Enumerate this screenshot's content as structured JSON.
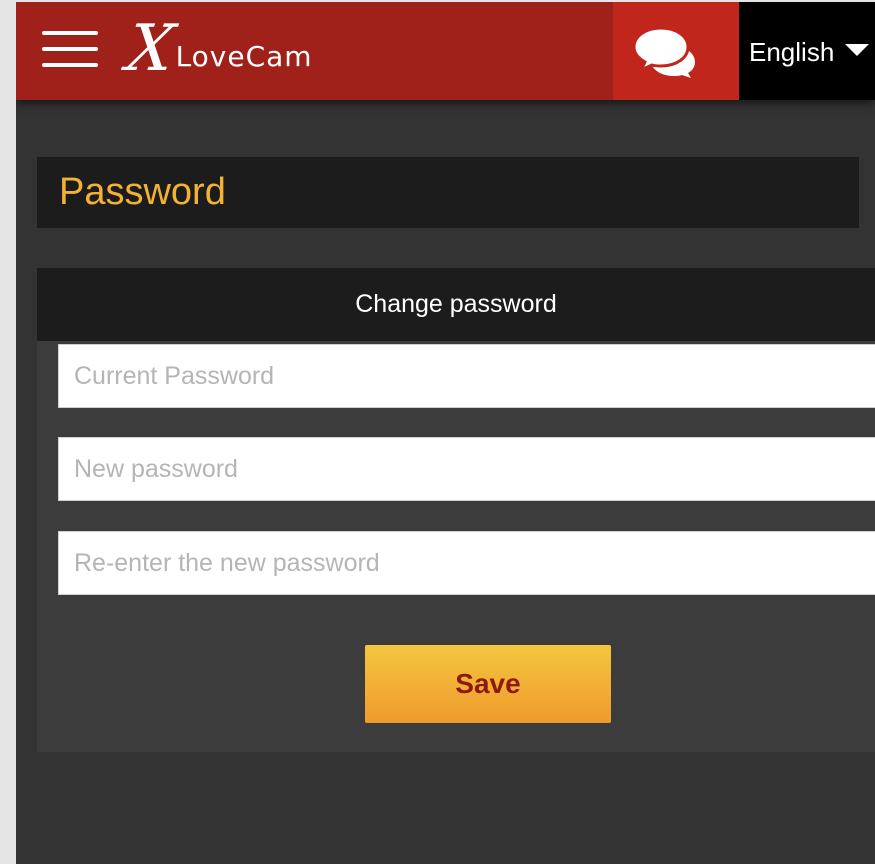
{
  "header": {
    "logo_x": "X",
    "logo_text": "LoveCam",
    "language": "English"
  },
  "page": {
    "title": "Password"
  },
  "form": {
    "heading": "Change password",
    "current_placeholder": "Current Password",
    "new_placeholder": "New password",
    "confirm_placeholder": "Re-enter the new password",
    "save_label": "Save"
  },
  "colors": {
    "header_bg": "#a0211a",
    "chat_bg": "#c1261d",
    "title_text": "#f2b233",
    "button_gradient": [
      "#f4c63f",
      "#f09a2d"
    ],
    "button_text": "#8c1b0f"
  },
  "icons": {
    "menu": "hamburger-menu-icon",
    "chat": "chat-bubbles-icon",
    "language_caret": "caret-down-icon"
  }
}
